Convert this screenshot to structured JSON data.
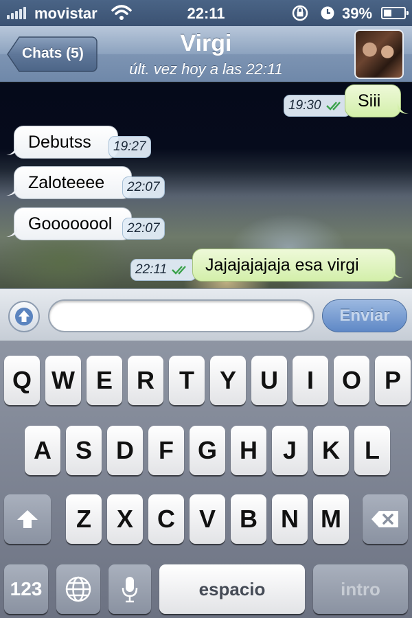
{
  "status_bar": {
    "carrier": "movistar",
    "time": "22:11",
    "battery_percent": "39%",
    "battery_level": 0.39,
    "icons": [
      "signal-icon",
      "wifi-icon",
      "rotation-lock-icon",
      "alarm-icon",
      "battery-icon"
    ]
  },
  "nav": {
    "back_label": "Chats (5)",
    "contact_name": "Virgi",
    "last_seen": "últ. vez hoy a las 22:11"
  },
  "messages": [
    {
      "direction": "out",
      "text": "Siii",
      "time": "19:30",
      "read": true
    },
    {
      "direction": "in",
      "text": "Debutss",
      "time": "19:27"
    },
    {
      "direction": "in",
      "text": "Zaloteeee",
      "time": "22:07"
    },
    {
      "direction": "in",
      "text": "Goooooool",
      "time": "22:07"
    },
    {
      "direction": "out",
      "text": "Jajajajajaja esa virgi",
      "time": "22:11",
      "read": true
    }
  ],
  "composer": {
    "placeholder": "",
    "send_label": "Enviar"
  },
  "keyboard": {
    "row1": [
      "Q",
      "W",
      "E",
      "R",
      "T",
      "Y",
      "U",
      "I",
      "O",
      "P"
    ],
    "row2": [
      "A",
      "S",
      "D",
      "F",
      "G",
      "H",
      "J",
      "K",
      "L"
    ],
    "row3": [
      "Z",
      "X",
      "C",
      "V",
      "B",
      "N",
      "M"
    ],
    "numbers_label": "123",
    "space_label": "espacio",
    "return_label": "intro"
  },
  "colors": {
    "outgoing_bubble": "#dcf3b8",
    "incoming_bubble": "#ffffff",
    "send_button": "#6f95cf",
    "read_ticks": "#3aa24a"
  }
}
